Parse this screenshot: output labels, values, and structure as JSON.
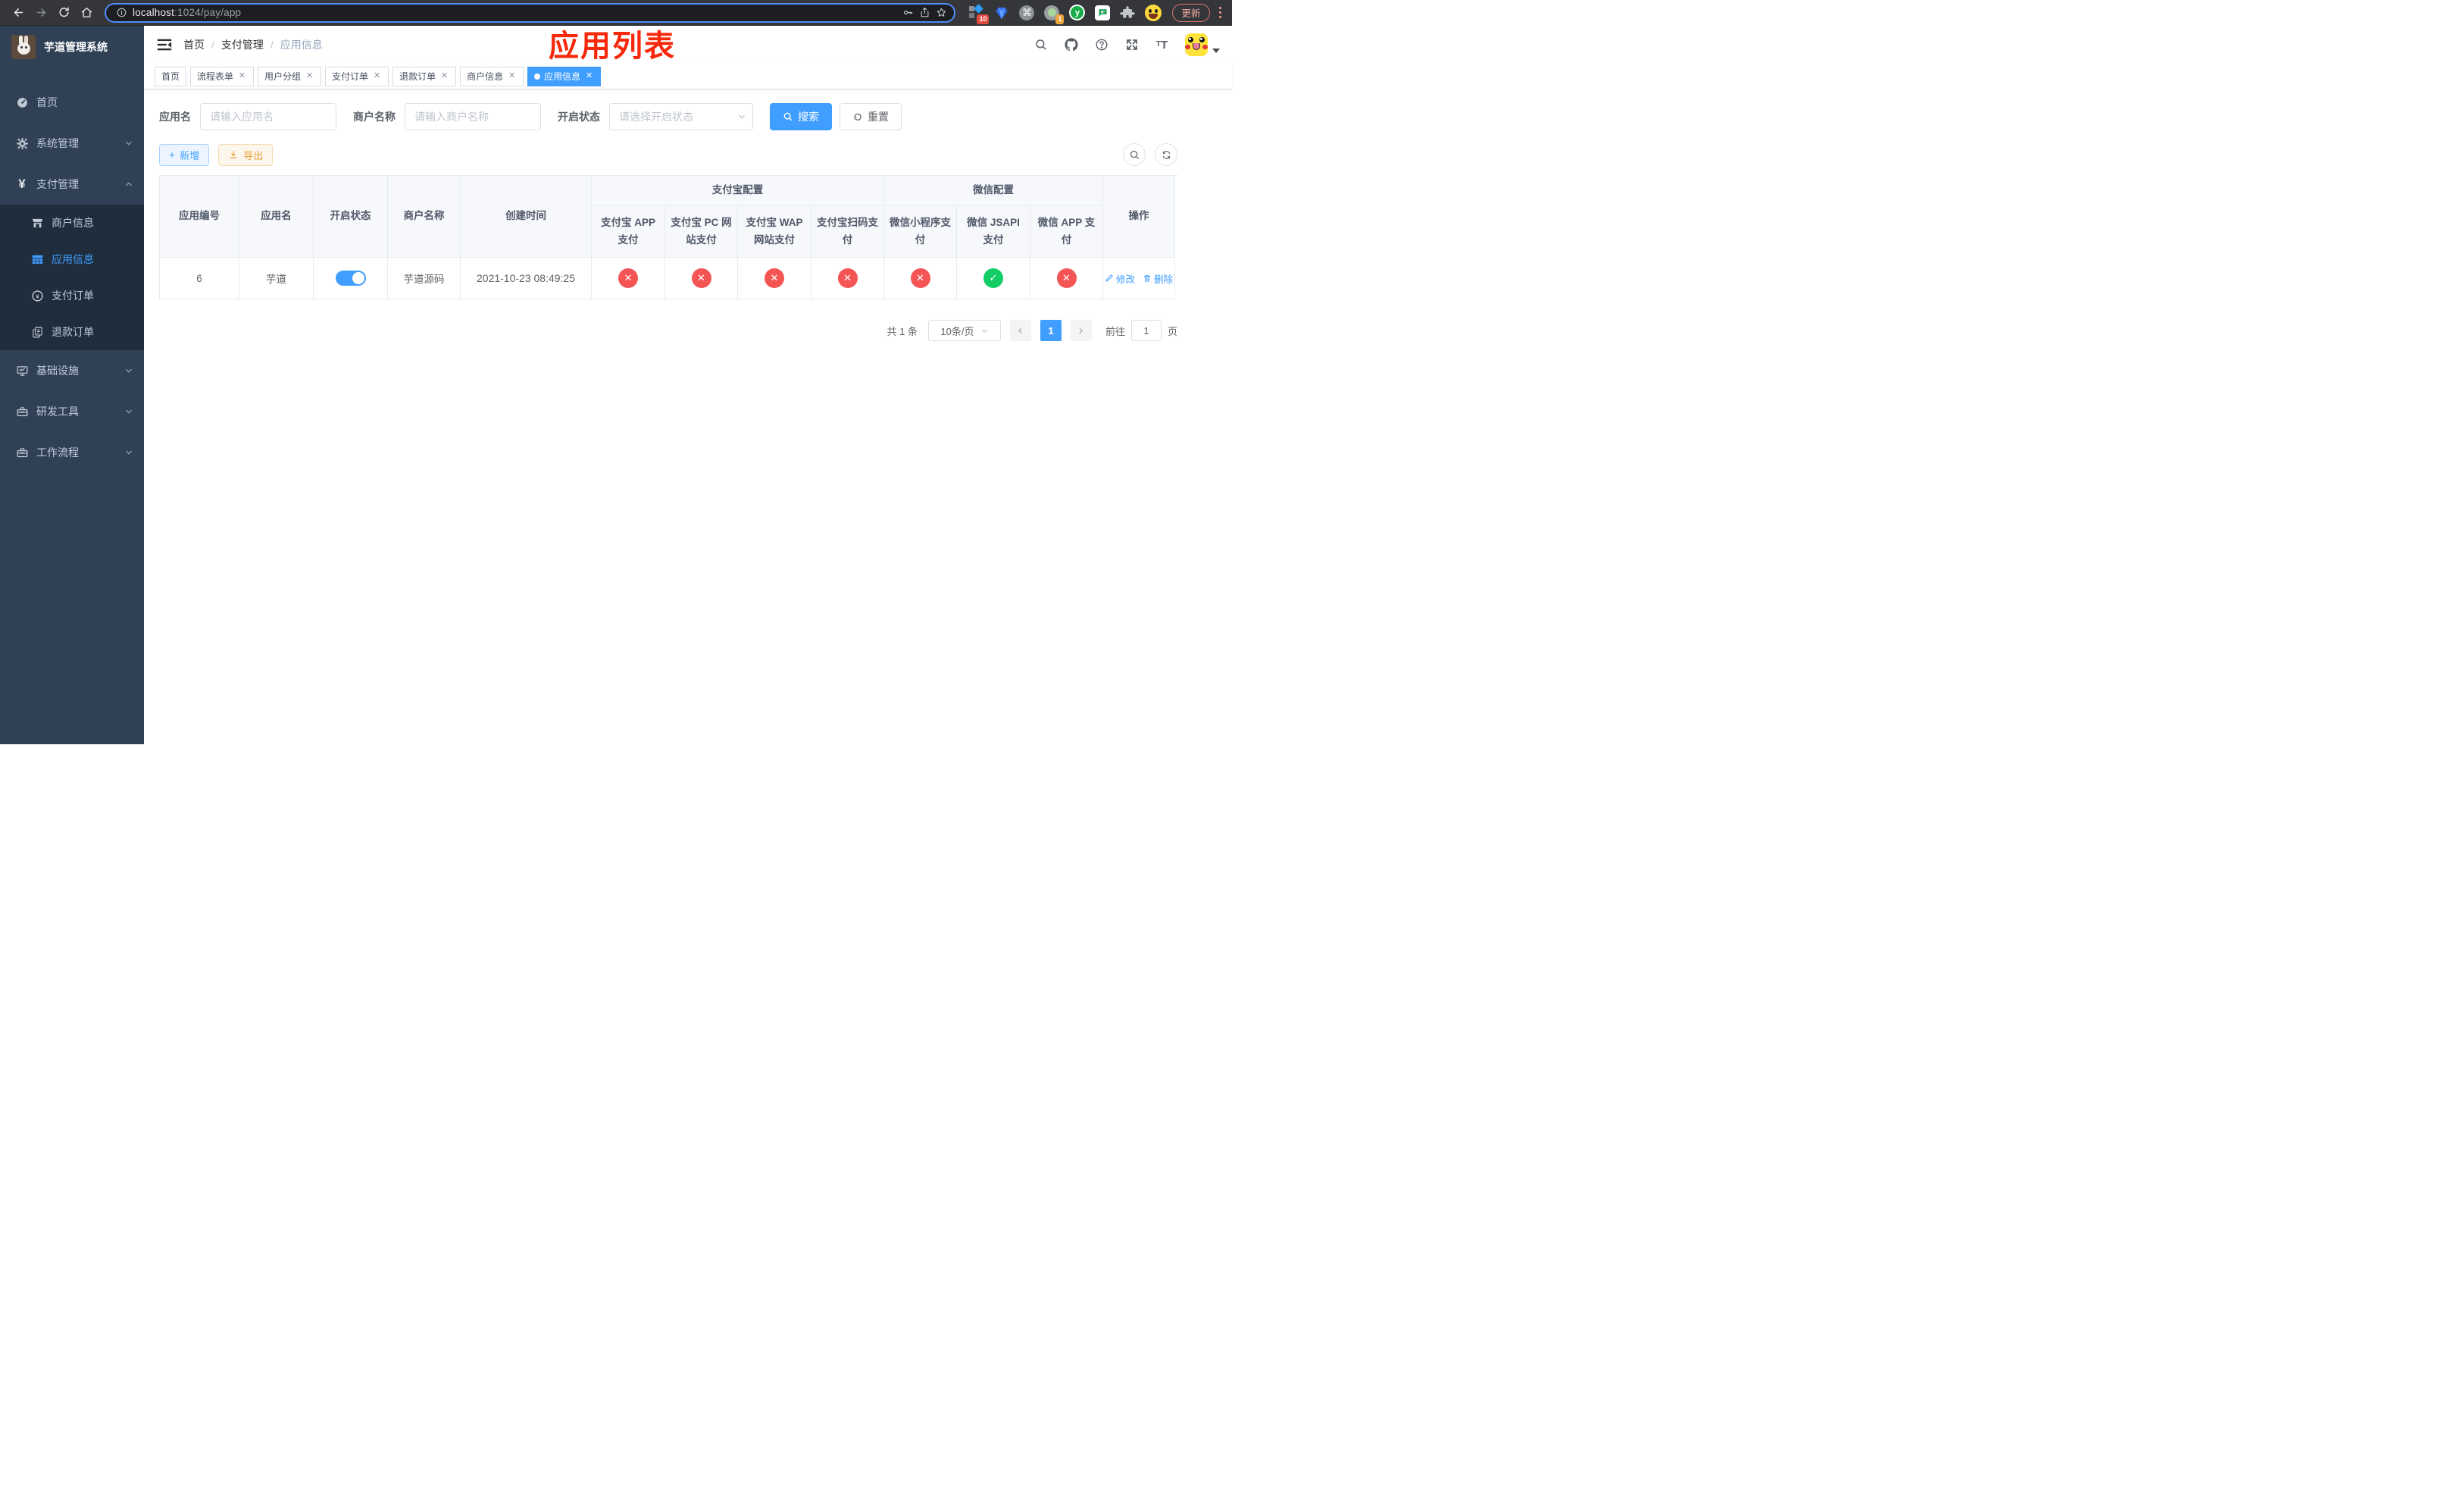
{
  "browser": {
    "url": {
      "host": "localhost",
      "path": ":1024/pay/app"
    },
    "update_label": "更新",
    "extensions": {
      "badge_blocks": "10",
      "badge_target": "1",
      "y_letter": "y",
      "cmd_glyph": "⌘"
    }
  },
  "sidebar": {
    "title": "芋道管理系统",
    "menu": [
      {
        "label": "首页"
      },
      {
        "label": "系统管理"
      },
      {
        "label": "支付管理"
      },
      {
        "label": "商户信息"
      },
      {
        "label": "应用信息"
      },
      {
        "label": "支付订单"
      },
      {
        "label": "退款订单"
      },
      {
        "label": "基础设施"
      },
      {
        "label": "研发工具"
      },
      {
        "label": "工作流程"
      }
    ]
  },
  "navbar": {
    "breadcrumb": [
      "首页",
      "支付管理",
      "应用信息"
    ],
    "separator": "/"
  },
  "overlay_title": "应用列表",
  "tabs": [
    {
      "label": "首页"
    },
    {
      "label": "流程表单"
    },
    {
      "label": "用户分组"
    },
    {
      "label": "支付订单"
    },
    {
      "label": "退款订单"
    },
    {
      "label": "商户信息"
    },
    {
      "label": "应用信息"
    }
  ],
  "tab_close_glyph": "✕",
  "filters": {
    "app_name_label": "应用名",
    "app_name_placeholder": "请输入应用名",
    "merchant_label": "商户名称",
    "merchant_placeholder": "请输入商户名称",
    "status_label": "开启状态",
    "status_placeholder": "请选择开启状态",
    "search_label": "搜索",
    "reset_label": "重置"
  },
  "toolbar": {
    "add_label": "新增",
    "export_label": "导出"
  },
  "table": {
    "groups": {
      "alipay": "支付宝配置",
      "wechat": "微信配置"
    },
    "columns": [
      "应用编号",
      "应用名",
      "开启状态",
      "商户名称",
      "创建时间",
      "支付宝 APP 支付",
      "支付宝 PC 网站支付",
      "支付宝 WAP 网站支付",
      "支付宝扫码支付",
      "微信小程序支付",
      "微信 JSAPI 支付",
      "微信 APP 支付",
      "操作"
    ],
    "row": {
      "id": "6",
      "name": "芋道",
      "enabled": "true",
      "merchant": "芋道源码",
      "created_at": "2021-10-23 08:49:25",
      "channels": [
        "no",
        "no",
        "no",
        "no",
        "no",
        "yes",
        "no"
      ],
      "edit_label": "修改",
      "delete_label": "删除"
    }
  },
  "pagination": {
    "total": "共 1 条",
    "page_size": "10条/页",
    "current_page": "1",
    "goto_label": "前往",
    "goto_value": "1",
    "page_unit": "页"
  },
  "colors": {
    "accent": "#409eff",
    "success": "#13ce66",
    "danger": "#f45454",
    "warning": "#e6a23c",
    "sidebar_bg": "#304156",
    "submenu_bg": "#1f2d3d",
    "annotation_red": "#f8290b"
  }
}
